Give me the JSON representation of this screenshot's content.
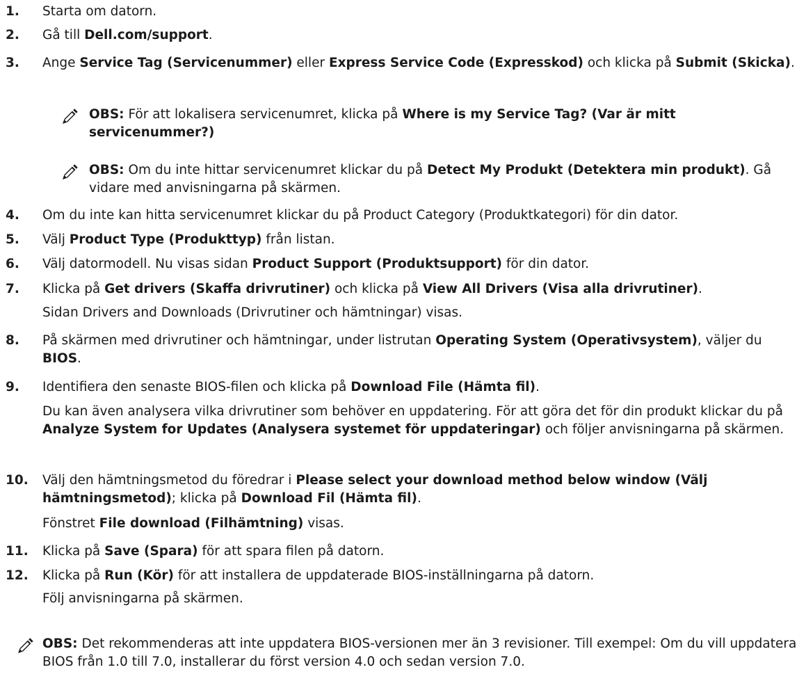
{
  "steps": [
    {
      "n": "1.",
      "parts": [
        {
          "t": "Starta om datorn."
        }
      ]
    },
    {
      "n": "2.",
      "parts": [
        {
          "t": "Gå till "
        },
        {
          "t": "Dell.com/support",
          "b": true
        },
        {
          "t": "."
        }
      ]
    },
    {
      "n": "3.",
      "parts": [
        {
          "t": "Ange "
        },
        {
          "t": "Service Tag (Servicenummer)",
          "b": true
        },
        {
          "t": " eller "
        },
        {
          "t": "Express Service Code (Expresskod)",
          "b": true
        },
        {
          "t": " och klicka på "
        },
        {
          "t": "Submit (Skicka)",
          "b": true
        },
        {
          "t": "."
        }
      ]
    },
    {
      "n": "4.",
      "parts": [
        {
          "t": "Om du inte kan hitta servicenumret klickar du på Product Category (Produktkategori) för din dator."
        }
      ]
    },
    {
      "n": "5.",
      "parts": [
        {
          "t": "Välj "
        },
        {
          "t": "Product Type (Produkttyp)",
          "b": true
        },
        {
          "t": " från listan."
        }
      ]
    },
    {
      "n": "6.",
      "parts": [
        {
          "t": "Välj datormodell. Nu visas sidan "
        },
        {
          "t": "Product Support (Produktsupport)",
          "b": true
        },
        {
          "t": " för din dator."
        }
      ]
    },
    {
      "n": "7.",
      "parts": [
        {
          "t": "Klicka på "
        },
        {
          "t": "Get drivers (Skaffa drivrutiner)",
          "b": true
        },
        {
          "t": " och klicka på "
        },
        {
          "t": "View All Drivers (Visa alla drivrutiner)",
          "b": true
        },
        {
          "t": "."
        }
      ]
    },
    {
      "n": "8.",
      "parts": [
        {
          "t": "På skärmen med drivrutiner och hämtningar, under listrutan "
        },
        {
          "t": "Operating System (Operativsystem)",
          "b": true
        },
        {
          "t": ", väljer du "
        },
        {
          "t": "BIOS",
          "b": true
        },
        {
          "t": "."
        }
      ]
    },
    {
      "n": "9.",
      "parts": [
        {
          "t": "Identifiera den senaste BIOS-filen och klicka på "
        },
        {
          "t": "Download File (Hämta fil)",
          "b": true
        },
        {
          "t": "."
        }
      ]
    },
    {
      "n": "10.",
      "parts": [
        {
          "t": "Välj den hämtningsmetod du föredrar i "
        },
        {
          "t": "Please select your download method below window (Välj hämtningsmetod)",
          "b": true
        },
        {
          "t": "; klicka på "
        },
        {
          "t": "Download Fil (Hämta fil)",
          "b": true
        },
        {
          "t": "."
        }
      ]
    },
    {
      "n": "11.",
      "parts": [
        {
          "t": "Klicka på "
        },
        {
          "t": "Save (Spara)",
          "b": true
        },
        {
          "t": " för att spara filen på datorn."
        }
      ]
    },
    {
      "n": "12.",
      "parts": [
        {
          "t": "Klicka på "
        },
        {
          "t": "Run (Kör)",
          "b": true
        },
        {
          "t": " för att installera de uppdaterade BIOS-inställningarna på datorn."
        }
      ]
    }
  ],
  "notes": [
    {
      "parts": [
        {
          "t": "OBS:",
          "b": true
        },
        {
          "t": " För att lokalisera servicenumret, klicka på "
        },
        {
          "t": "Where is my Service Tag? (Var är mitt servicenummer?)",
          "b": true
        }
      ]
    },
    {
      "parts": [
        {
          "t": "OBS:",
          "b": true
        },
        {
          "t": " Om du inte hittar servicenumret klickar du på "
        },
        {
          "t": "Detect My Produkt (Detektera min produkt)",
          "b": true
        },
        {
          "t": ". Gå vidare med anvisningarna på skärmen."
        }
      ]
    },
    {
      "parts": [
        {
          "t": "OBS:",
          "b": true
        },
        {
          "t": " Det rekommenderas att inte uppdatera BIOS-versionen mer än 3 revisioner. Till exempel: Om du vill uppdatera BIOS från 1.0 till 7.0, installerar du först version 4.0 och sedan version 7.0."
        }
      ]
    }
  ],
  "subs": [
    {
      "parts": [
        {
          "t": "Sidan Drivers and Downloads (Drivrutiner och hämtningar) visas."
        }
      ]
    },
    {
      "parts": [
        {
          "t": "Du kan även analysera vilka drivrutiner som behöver en uppdatering. För att göra det för din produkt klickar du på "
        },
        {
          "t": "Analyze System for Updates (Analysera systemet för uppdateringar)",
          "b": true
        },
        {
          "t": " och följer anvisningarna på skärmen."
        }
      ]
    },
    {
      "parts": [
        {
          "t": "Fönstret "
        },
        {
          "t": "File download (Filhämtning)",
          "b": true
        },
        {
          "t": " visas."
        }
      ]
    },
    {
      "parts": [
        {
          "t": "Följ anvisningarna på skärmen."
        }
      ]
    }
  ],
  "icon": {
    "name": "note-pencil-icon",
    "color": "#1a1a1a"
  }
}
